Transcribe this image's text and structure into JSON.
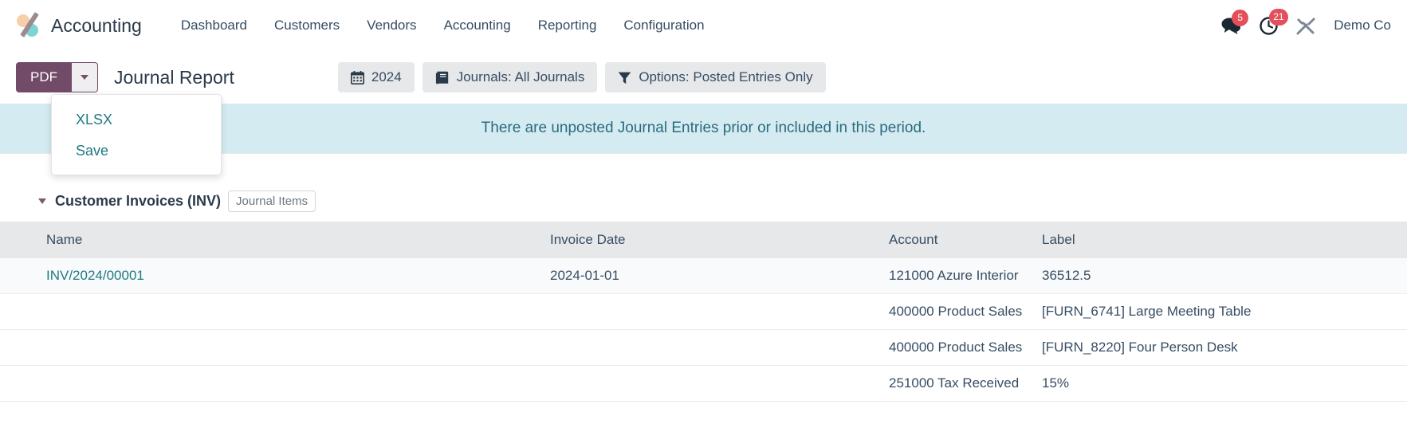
{
  "navbar": {
    "brand": "Accounting",
    "menu": [
      {
        "label": "Dashboard"
      },
      {
        "label": "Customers"
      },
      {
        "label": "Vendors"
      },
      {
        "label": "Accounting"
      },
      {
        "label": "Reporting"
      },
      {
        "label": "Configuration"
      }
    ],
    "messages_badge": "5",
    "activities_badge": "21",
    "user": "Demo Co"
  },
  "control_panel": {
    "pdf_label": "PDF",
    "report_title": "Journal Report",
    "filters": [
      {
        "icon": "calendar-icon",
        "label": "2024"
      },
      {
        "icon": "book-icon",
        "label": "Journals: All Journals"
      },
      {
        "icon": "funnel-icon",
        "label": "Options: Posted Entries Only"
      }
    ]
  },
  "dropdown": {
    "items": [
      {
        "label": "XLSX"
      },
      {
        "label": "Save"
      }
    ]
  },
  "alert": {
    "message": "There are unposted Journal Entries prior or included in this period."
  },
  "report": {
    "section_title": "Customer Invoices (INV)",
    "section_chip": "Journal Items",
    "columns": [
      "Name",
      "Invoice Date",
      "Account",
      "Label"
    ],
    "rows": [
      {
        "name": "INV/2024/00001",
        "name_is_link": true,
        "invoice_date": "2024-01-01",
        "account": "121000 Azure Interior",
        "label": "36512.5"
      },
      {
        "name": "",
        "name_is_link": false,
        "invoice_date": "",
        "account": "400000 Product Sales",
        "label": "[FURN_6741] Large Meeting Table"
      },
      {
        "name": "",
        "name_is_link": false,
        "invoice_date": "",
        "account": "400000 Product Sales",
        "label": "[FURN_8220] Four Person Desk"
      },
      {
        "name": "",
        "name_is_link": false,
        "invoice_date": "",
        "account": "251000 Tax Received",
        "label": "15%"
      }
    ]
  },
  "colors": {
    "brand_purple": "#714B67",
    "alert_bg": "#D4ECF1",
    "alert_text": "#2D6A7E",
    "link_teal": "#1F7A80",
    "badge_red": "#E34F5A",
    "header_row_bg": "#E6E8EA"
  }
}
